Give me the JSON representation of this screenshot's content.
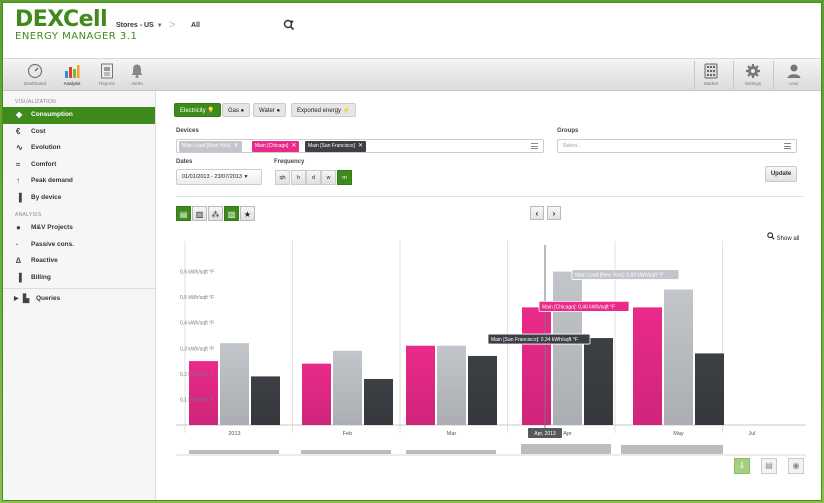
{
  "header": {
    "logo_main": "DEXCell",
    "logo_sub": "ENERGY MANAGER 3.1",
    "breadcrumb": {
      "store": "Stores - US",
      "scope": "All"
    }
  },
  "toolbar": {
    "left": [
      {
        "label": "Dashboard",
        "icon": "gauge-icon"
      },
      {
        "label": "Analysis",
        "icon": "bar-chart-icon"
      },
      {
        "label": "Reports",
        "icon": "report-icon"
      },
      {
        "label": "Alerts",
        "icon": "bell-icon"
      }
    ],
    "right": [
      {
        "label": "Market",
        "icon": "calculator-icon"
      },
      {
        "label": "Settings",
        "icon": "gear-icon"
      },
      {
        "label": "User",
        "icon": "user-icon"
      }
    ]
  },
  "sidebar": {
    "visualization_title": "VISUALIZATION",
    "visualization": [
      {
        "label": "Consumption",
        "icon": "consumption-icon",
        "glyph": "◆"
      },
      {
        "label": "Cost",
        "icon": "cost-icon",
        "glyph": "€"
      },
      {
        "label": "Evolution",
        "icon": "evolution-icon",
        "glyph": "∿"
      },
      {
        "label": "Comfort",
        "icon": "comfort-icon",
        "glyph": "≈"
      },
      {
        "label": "Peak demand",
        "icon": "peak-demand-icon",
        "glyph": "↑"
      },
      {
        "label": "By device",
        "icon": "by-device-icon",
        "glyph": "▐"
      }
    ],
    "analysis_title": "ANALYSIS",
    "analysis": [
      {
        "label": "M&V Projects",
        "icon": "piggy-bank-icon",
        "glyph": "●"
      },
      {
        "label": "Passive cons.",
        "icon": "passive-cons-icon",
        "glyph": "∙"
      },
      {
        "label": "Reactive",
        "icon": "reactive-icon",
        "glyph": "∆"
      },
      {
        "label": "Billing",
        "icon": "billing-icon",
        "glyph": "▐"
      }
    ],
    "queries_label": "Queries"
  },
  "energy_tabs": [
    {
      "label": "Electricity",
      "icon": "bulb-icon",
      "active": true
    },
    {
      "label": "Gas",
      "icon": "flame-icon",
      "active": false
    },
    {
      "label": "Water",
      "icon": "drop-icon",
      "active": false
    },
    {
      "label": "Exported energy",
      "icon": "export-icon",
      "active": false
    }
  ],
  "filters": {
    "devices_label": "Devices",
    "devices": [
      {
        "label": "Main Load [New York]",
        "color": "#c2c5ca",
        "text_color": "#ffffff"
      },
      {
        "label": "Main [Chicago]",
        "color": "#ea2a8a",
        "text_color": "#ffffff"
      },
      {
        "label": "Main [San Francisco]",
        "color": "#3c3f44",
        "text_color": "#ffffff"
      }
    ],
    "groups_label": "Groups",
    "groups_placeholder": "Select...",
    "dates_label": "Dates",
    "dates_value": "01/01/2013 - 23/07/2013",
    "frequency_label": "Frequency",
    "frequency_options": [
      "qh",
      "h",
      "d",
      "w",
      "m"
    ],
    "frequency_selected": "m",
    "update_label": "Update"
  },
  "chart_controls": {
    "show_all": "Show all"
  },
  "chart_data": {
    "type": "bar",
    "categories": [
      "2013",
      "Feb",
      "Mar",
      "Apr",
      "May"
    ],
    "axis_extra_categories": [
      "Jul"
    ],
    "y_unit": "kWh/sqft °F",
    "yticks": [
      "0,1 kWh/sqft °F",
      "0,2 kWh/sqft °F",
      "0,3 kWh/sqft °F",
      "0,4 kWh/sqft °F",
      "0,5 kWh/sqft °F",
      "0,6 kWh/sqft °F"
    ],
    "yvals": [
      0.1,
      0.2,
      0.3,
      0.4,
      0.5,
      0.6
    ],
    "ylim": [
      0,
      0.7
    ],
    "series": [
      {
        "name": "Main [Chicago]",
        "color": "#ea2a8a",
        "values": [
          0.25,
          0.24,
          0.31,
          0.46,
          0.46
        ]
      },
      {
        "name": "Main Load [New York]",
        "color": "#c2c5ca",
        "values": [
          0.32,
          0.29,
          0.31,
          0.6,
          0.53
        ]
      },
      {
        "name": "Main [San Francisco]",
        "color": "#3c3f44",
        "values": [
          0.19,
          0.18,
          0.27,
          0.34,
          0.28
        ]
      }
    ],
    "tooltips": [
      "Main Load [New York]: 0,60 kWh/sqft °F",
      "Main [Chicago]: 0,46 kWh/sqft °F",
      "Main [San Francisco]: 0,34 kWh/sqft °F"
    ],
    "crosshair_label": "Apr, 2013",
    "grid": true,
    "legend": "none"
  }
}
